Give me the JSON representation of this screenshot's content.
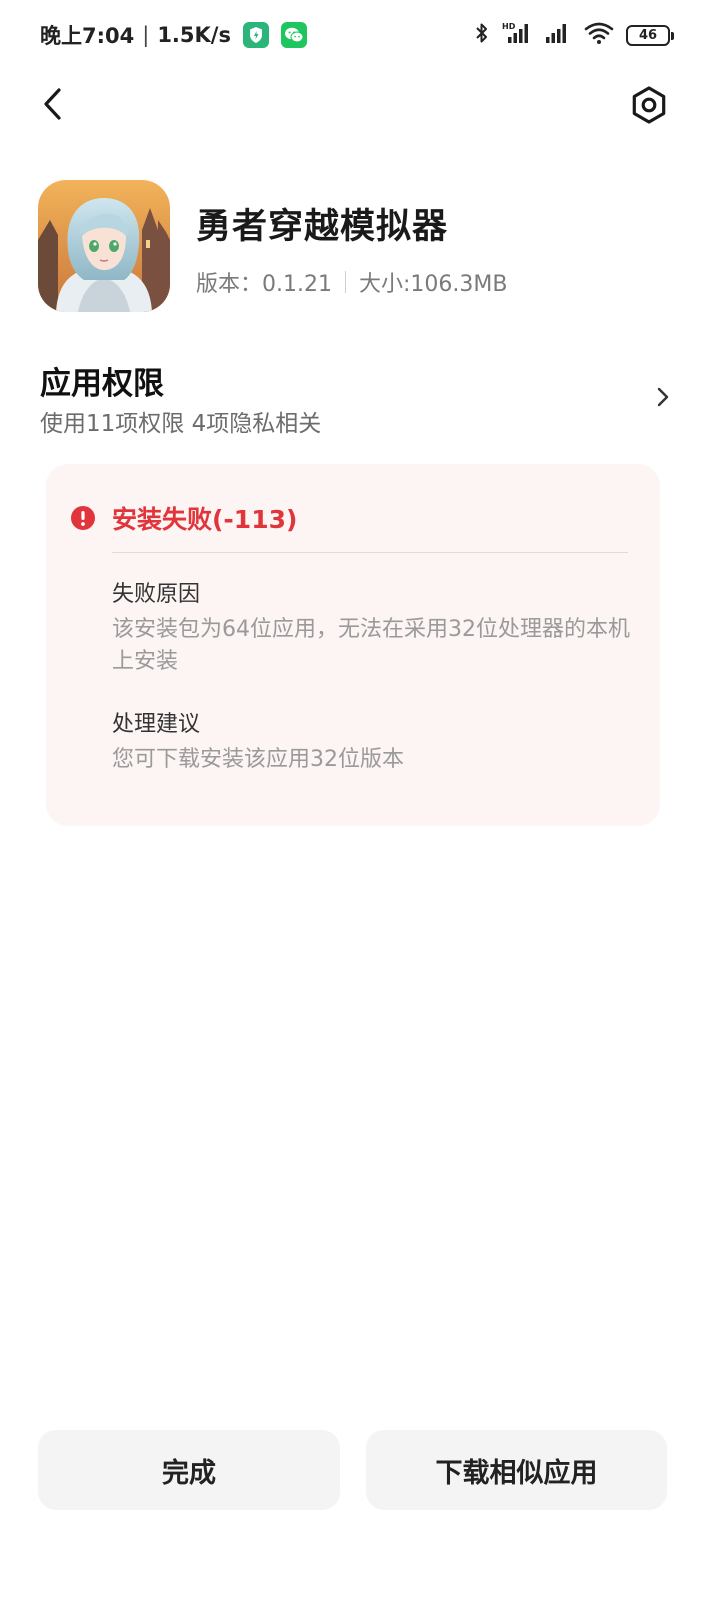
{
  "status_bar": {
    "time": "晚上7:04",
    "separator": "|",
    "net_speed": "1.5K/s",
    "battery": "46",
    "hd_label": "HD",
    "icons": [
      "shield-app-icon",
      "wechat-icon",
      "bluetooth-icon",
      "signal-hd-icon",
      "signal-icon",
      "wifi-icon",
      "battery-icon"
    ]
  },
  "nav": {
    "back_icon": "back-chevron-icon",
    "settings_icon": "settings-hexagon-icon"
  },
  "app": {
    "name": "勇者穿越模拟器",
    "version": "版本：0.1.21",
    "size": "大小:106.3MB",
    "icon": "app-icon-anime-character"
  },
  "permissions": {
    "title": "应用权限",
    "subtitle": "使用11项权限 4项隐私相关"
  },
  "error": {
    "title": "安装失败(-113)",
    "reason_label": "失败原因",
    "reason_text": "该安装包为64位应用，无法在采用32位处理器的本机上安装",
    "suggestion_label": "处理建议",
    "suggestion_text": "您可下载安装该应用32位版本"
  },
  "buttons": {
    "done": "完成",
    "similar": "下载相似应用"
  },
  "colors": {
    "error_red": "#e0353b",
    "card_bg": "#fdf4f4",
    "button_bg": "#f4f4f4",
    "wechat_green": "#1fc55f",
    "shield_green": "#2bb57a"
  }
}
